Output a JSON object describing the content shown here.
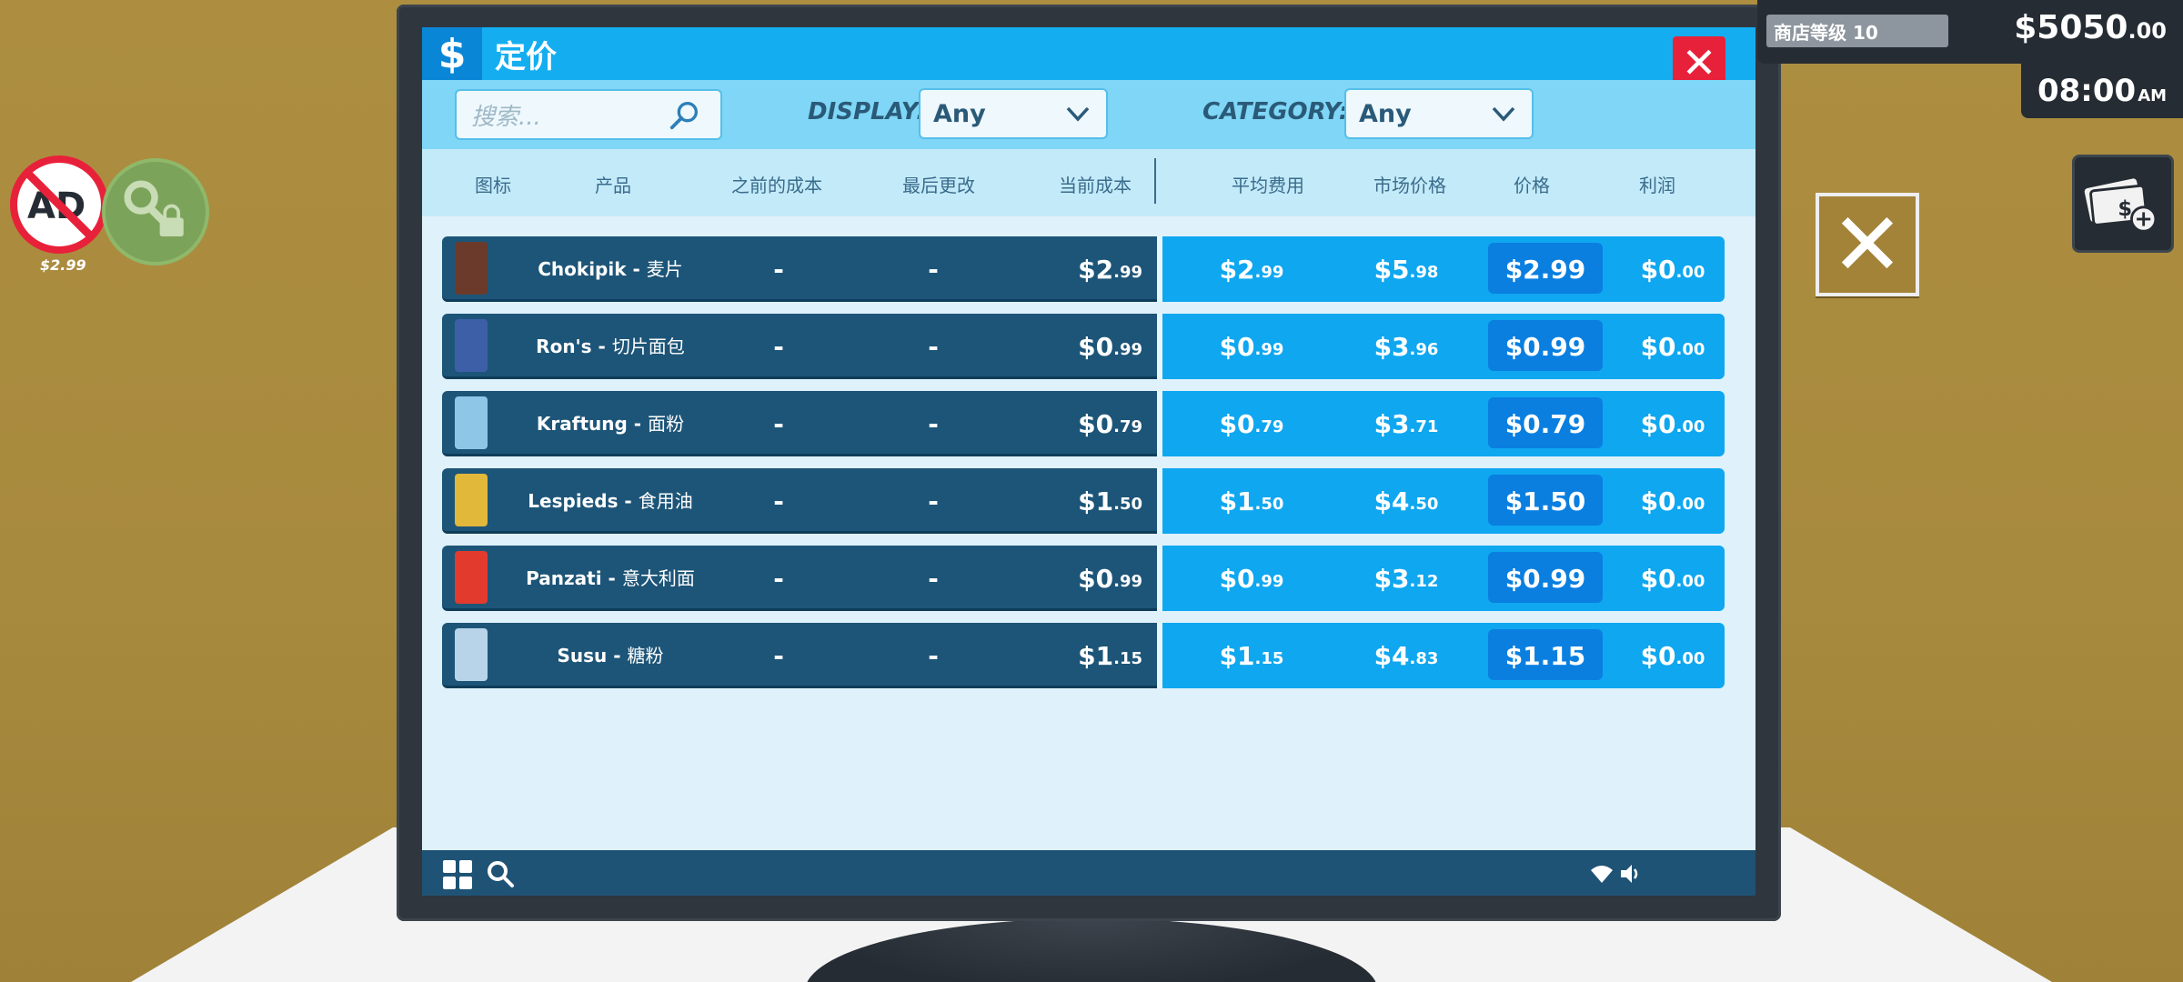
{
  "window": {
    "title_icon": "$",
    "title": "定价",
    "close_icon": "close-icon"
  },
  "filters": {
    "search_placeholder": "搜索...",
    "display_label": "DISPLAY:",
    "display_value": "Any",
    "category_label": "CATEGORY:",
    "category_value": "Any"
  },
  "columns": [
    "图标",
    "产品",
    "之前的成本",
    "最后更改",
    "当前成本",
    "平均费用",
    "市场价格",
    "价格",
    "利润"
  ],
  "products": [
    {
      "brand": "Chokipik",
      "name": "麦片",
      "prev_cost": "-",
      "last_change": "-",
      "cur_cost": "$2",
      "cur_cost_c": ".99",
      "avg": "$2",
      "avg_c": ".99",
      "market": "$5",
      "market_c": ".98",
      "price": "$2.99",
      "profit": "$0",
      "profit_c": ".00",
      "thumb_color": "#6b3a2a"
    },
    {
      "brand": "Ron's",
      "name": "切片面包",
      "prev_cost": "-",
      "last_change": "-",
      "cur_cost": "$0",
      "cur_cost_c": ".99",
      "avg": "$0",
      "avg_c": ".99",
      "market": "$3",
      "market_c": ".96",
      "price": "$0.99",
      "profit": "$0",
      "profit_c": ".00",
      "thumb_color": "#3d5fa8"
    },
    {
      "brand": "Kraftung",
      "name": "面粉",
      "prev_cost": "-",
      "last_change": "-",
      "cur_cost": "$0",
      "cur_cost_c": ".79",
      "avg": "$0",
      "avg_c": ".79",
      "market": "$3",
      "market_c": ".71",
      "price": "$0.79",
      "profit": "$0",
      "profit_c": ".00",
      "thumb_color": "#8ec6e8"
    },
    {
      "brand": "Lespieds",
      "name": "食用油",
      "prev_cost": "-",
      "last_change": "-",
      "cur_cost": "$1",
      "cur_cost_c": ".50",
      "avg": "$1",
      "avg_c": ".50",
      "market": "$4",
      "market_c": ".50",
      "price": "$1.50",
      "profit": "$0",
      "profit_c": ".00",
      "thumb_color": "#e2b83a"
    },
    {
      "brand": "Panzati",
      "name": "意大利面",
      "prev_cost": "-",
      "last_change": "-",
      "cur_cost": "$0",
      "cur_cost_c": ".99",
      "avg": "$0",
      "avg_c": ".99",
      "market": "$3",
      "market_c": ".12",
      "price": "$0.99",
      "profit": "$0",
      "profit_c": ".00",
      "thumb_color": "#e33a2e"
    },
    {
      "brand": "Susu",
      "name": "糖粉",
      "prev_cost": "-",
      "last_change": "-",
      "cur_cost": "$1",
      "cur_cost_c": ".15",
      "avg": "$1",
      "avg_c": ".15",
      "market": "$4",
      "market_c": ".83",
      "price": "$1.15",
      "profit": "$0",
      "profit_c": ".00",
      "thumb_color": "#b8d4e8"
    }
  ],
  "hud": {
    "store_level": "商店等级 10",
    "money": "$5050",
    "money_cents": ".00",
    "time": "08:00",
    "time_suffix": "AM",
    "ad_label": "AD",
    "ad_price": "$2.99"
  },
  "colors": {
    "title_bar": "#14aef0",
    "row_dark": "#1d5578",
    "row_light": "#0fa7f0",
    "price_box": "#0a7fe0",
    "close_red": "#e8213a"
  }
}
